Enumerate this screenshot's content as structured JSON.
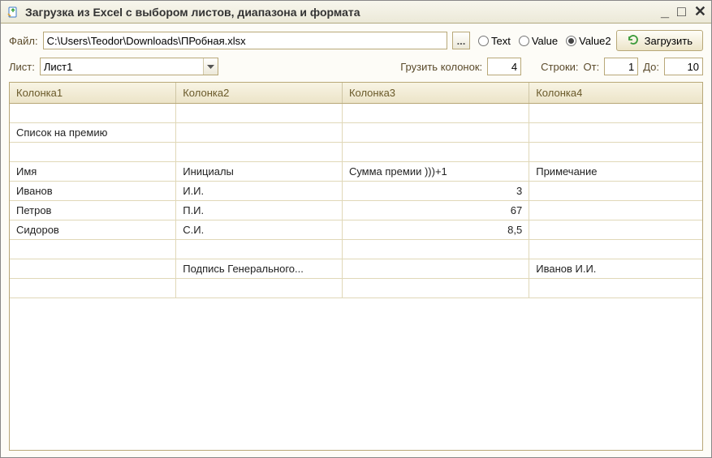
{
  "window": {
    "title": "Загрузка из Excel с выбором листов, диапазона и формата"
  },
  "toolbar": {
    "file_label": "Файл:",
    "file_path": "C:\\Users\\Teodor\\Downloads\\ПРобная.xlsx",
    "radio_text": "Text",
    "radio_value": "Value",
    "radio_value2": "Value2",
    "radio_selected": "Value2",
    "load_button": "Загрузить"
  },
  "row2": {
    "sheet_label": "Лист:",
    "sheet_value": "Лист1",
    "columns_label": "Грузить колонок:",
    "columns_value": "4",
    "rows_label": "Строки:",
    "from_label": "От:",
    "from_value": "1",
    "to_label": "До:",
    "to_value": "10"
  },
  "table": {
    "headers": [
      "Колонка1",
      "Колонка2",
      "Колонка3",
      "Колонка4"
    ],
    "rows": [
      {
        "c1": "",
        "c2": "",
        "c3": "",
        "c3num": false,
        "c4": ""
      },
      {
        "c1": "Список на премию",
        "c2": "",
        "c3": "",
        "c3num": false,
        "c4": ""
      },
      {
        "c1": "",
        "c2": "",
        "c3": "",
        "c3num": false,
        "c4": ""
      },
      {
        "c1": "Имя",
        "c2": "Инициалы",
        "c3": "Сумма премии )))+1",
        "c3num": false,
        "c4": "Примечание"
      },
      {
        "c1": "Иванов",
        "c2": "И.И.",
        "c3": "3",
        "c3num": true,
        "c4": ""
      },
      {
        "c1": "Петров",
        "c2": "П.И.",
        "c3": "67",
        "c3num": true,
        "c4": ""
      },
      {
        "c1": "Сидоров",
        "c2": "С.И.",
        "c3": "8,5",
        "c3num": true,
        "c4": ""
      },
      {
        "c1": "",
        "c2": "",
        "c3": "",
        "c3num": false,
        "c4": ""
      },
      {
        "c1": "",
        "c2": "Подпись Генерального...",
        "c3": "",
        "c3num": false,
        "c4": "Иванов И.И."
      },
      {
        "c1": "",
        "c2": "",
        "c3": "",
        "c3num": false,
        "c4": ""
      }
    ]
  }
}
